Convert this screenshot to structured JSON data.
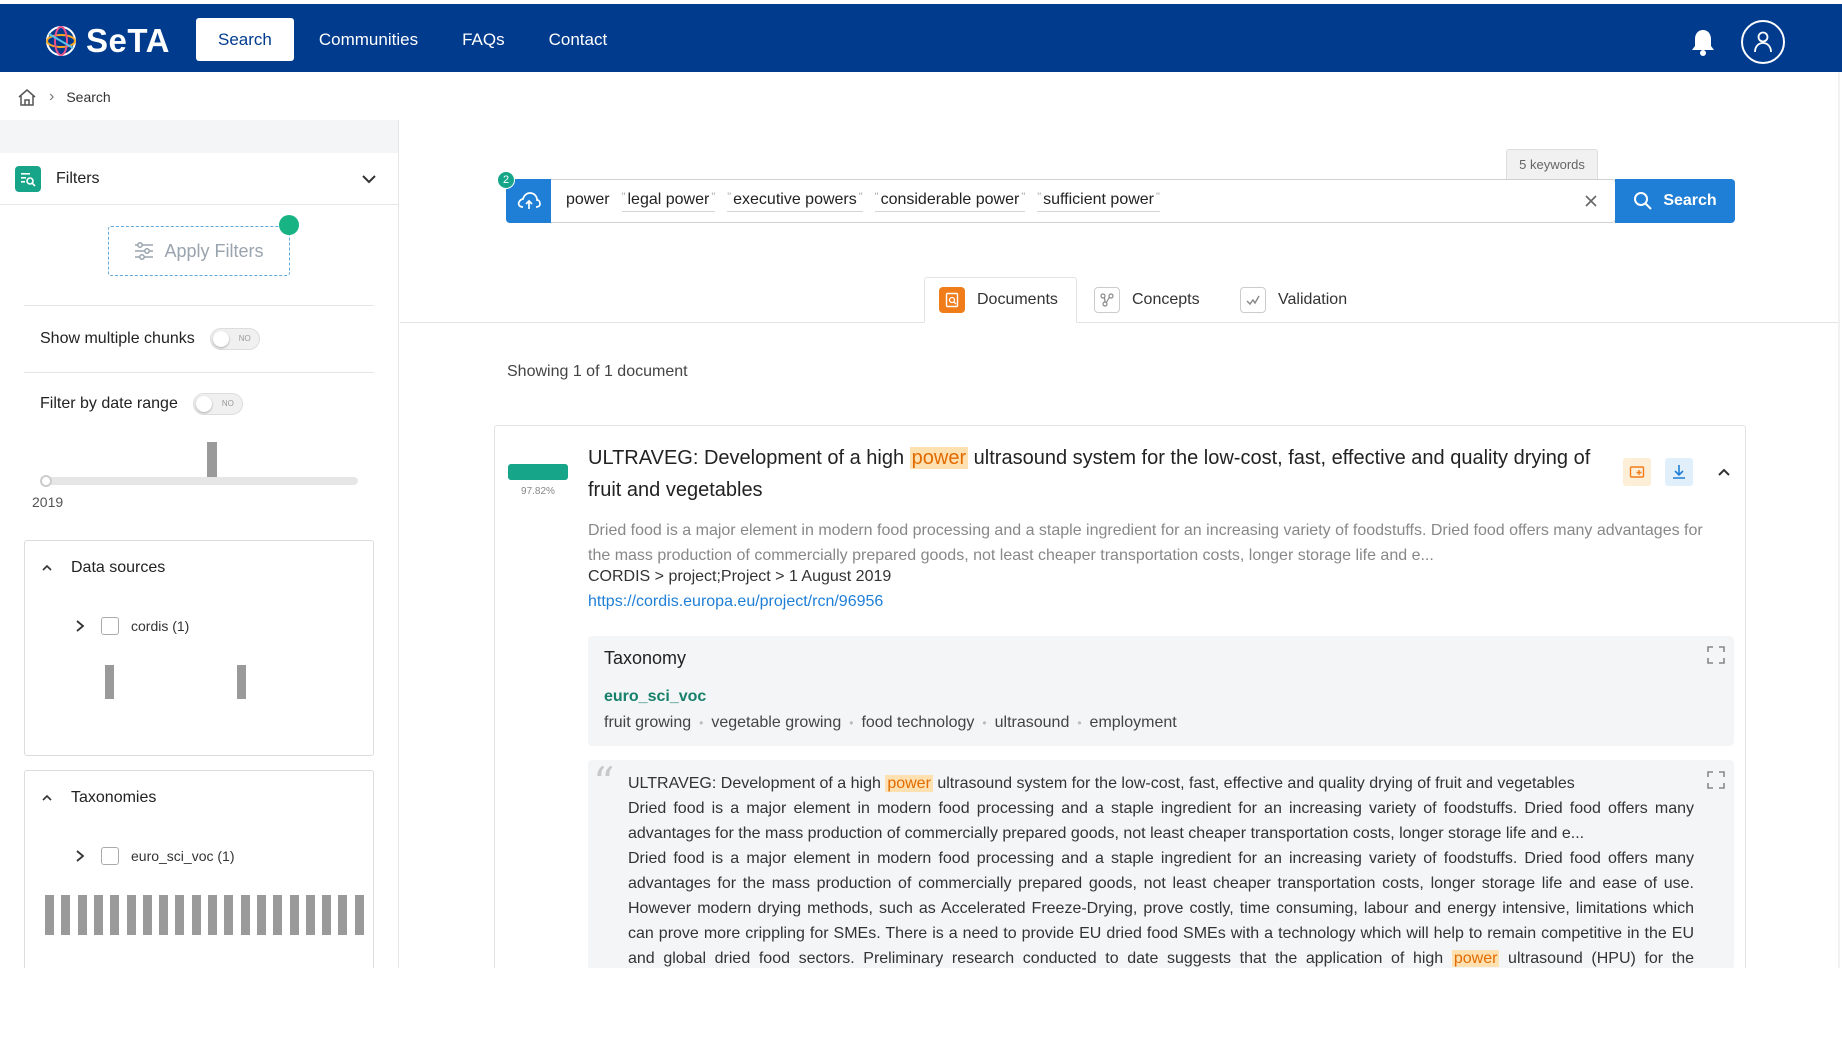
{
  "app": {
    "logo_text": "SeTA"
  },
  "nav": {
    "items": [
      {
        "label": "Search",
        "active": true
      },
      {
        "label": "Communities",
        "active": false
      },
      {
        "label": "FAQs",
        "active": false
      },
      {
        "label": "Contact",
        "active": false
      }
    ]
  },
  "breadcrumb": {
    "current": "Search"
  },
  "sidebar": {
    "filters_label": "Filters",
    "apply_label": "Apply Filters",
    "show_multiple_chunks": {
      "label": "Show multiple chunks",
      "toggle_text": "NO",
      "enabled": false
    },
    "date_range": {
      "label": "Filter by date range",
      "toggle_text": "NO",
      "enabled": false,
      "year": "2019"
    },
    "data_sources": {
      "title": "Data sources",
      "items": [
        {
          "label": "cordis (1)",
          "checked": false
        }
      ]
    },
    "taxonomies": {
      "title": "Taxonomies",
      "items": [
        {
          "label": "euro_sci_voc (1)",
          "checked": false
        }
      ]
    }
  },
  "search": {
    "keywords_badge": "5 keywords",
    "upload_count": "2",
    "terms": [
      "power",
      "legal power",
      "executive powers",
      "considerable power",
      "sufficient power"
    ],
    "button_label": "Search"
  },
  "tabs": [
    {
      "label": "Documents",
      "active": true
    },
    {
      "label": "Concepts",
      "active": false
    },
    {
      "label": "Validation",
      "active": false
    }
  ],
  "results": {
    "summary": "Showing 1 of 1 document",
    "document": {
      "score": "97.82%",
      "score_fraction": 0.9782,
      "title_before": "ULTRAVEG: Development of a high ",
      "title_highlight": "power",
      "title_after": " ultrasound system for the low-cost, fast, effective and quality drying of fruit and vegetables",
      "abstract": "Dried food is a major element in modern food processing and a staple ingredient for an increasing variety of foodstuffs. Dried food offers many advantages for the mass production of commercially prepared goods, not least cheaper transportation costs, longer storage life and e...",
      "meta": "CORDIS > project;Project > 1 August 2019",
      "url": "https://cordis.europa.eu/project/rcn/96956",
      "taxonomy": {
        "title": "Taxonomy",
        "name": "euro_sci_voc",
        "terms": [
          "fruit growing",
          "vegetable growing",
          "food technology",
          "ultrasound",
          "employment"
        ]
      },
      "chunk": {
        "line1_before": "ULTRAVEG: Development of a high ",
        "line1_highlight": "power",
        "line1_after": " ultrasound system for the low-cost, fast, effective and quality drying of fruit and vegetables",
        "para1": "Dried food is a major element in modern food processing and a staple ingredient for an increasing variety of foodstuffs. Dried food offers many advantages for the mass production of commercially prepared goods, not least cheaper transportation costs, longer storage life and e...",
        "para2_before": "Dried food is a major element in modern food processing and a staple ingredient for an increasing variety of foodstuffs. Dried food offers many advantages for the mass production of commercially prepared goods, not least cheaper transportation costs, longer storage life and ease of use. However modern drying methods, such as Accelerated Freeze-Drying, prove costly, time consuming, labour and energy intensive, limitations which can prove more crippling for SMEs. There is a need to provide EU dried food SMEs with a technology which will help to remain competitive in the EU and global dried food sectors. Preliminary research conducted to date suggests that the application of high ",
        "para2_highlight": "power",
        "para2_after": " ultrasound (HPU) for the dehydration of"
      }
    }
  },
  "colors": {
    "header": "#003b8e",
    "accent": "#1f7fd6",
    "green": "#17a58a",
    "highlight": "#ffe0b0"
  }
}
